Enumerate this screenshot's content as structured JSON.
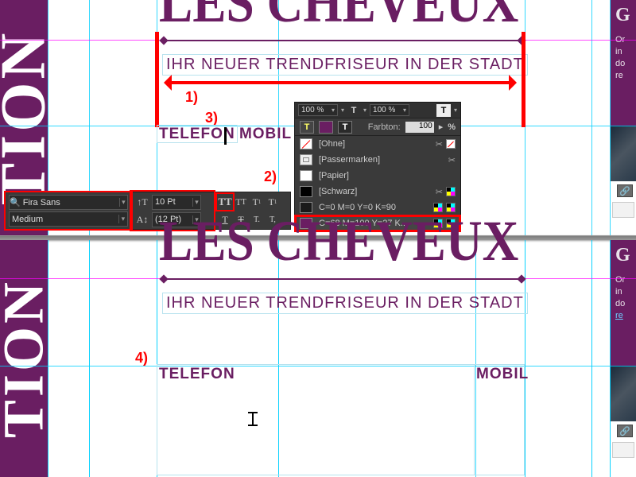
{
  "annotations": {
    "a1": "1)",
    "a2": "2)",
    "a3": "3)",
    "a4": "4)"
  },
  "doc": {
    "headline": "LES CHEVEUX",
    "subheadline": "IHR NEUER TRENDFRISEUR IN DER STADT",
    "telefon": "TELEFON",
    "mobil": "MOBIL"
  },
  "left_vertical_text": "TION",
  "right_peek": {
    "heading": "G",
    "body_top": "Or\nin\ndo\nre",
    "body_bottom": "Or\nin\ndo",
    "link": "re"
  },
  "char_panel": {
    "font": "Fira Sans",
    "weight": "Medium",
    "size": "10 Pt",
    "leading": "(12 Pt)"
  },
  "swatches": {
    "zoom_left": "100 %",
    "zoom_right": "100 %",
    "tint_label": "Farbton:",
    "tint_value": "100",
    "percent": "%",
    "rows": [
      {
        "name": "[Ohne]",
        "chip": "none",
        "tail": "xdash"
      },
      {
        "name": "[Passermarken]",
        "chip": "reg",
        "tail": "x"
      },
      {
        "name": "[Papier]",
        "chip": "paper",
        "tail": ""
      },
      {
        "name": "[Schwarz]",
        "chip": "black",
        "tail": "xcmyk"
      },
      {
        "name": "C=0 M=0 Y=0 K=90",
        "chip": "k90",
        "tail": "cmyk2"
      },
      {
        "name": "C=68 M=100 Y=27 K...",
        "chip": "brand",
        "tail": "cmyk2",
        "selected": true
      }
    ]
  }
}
